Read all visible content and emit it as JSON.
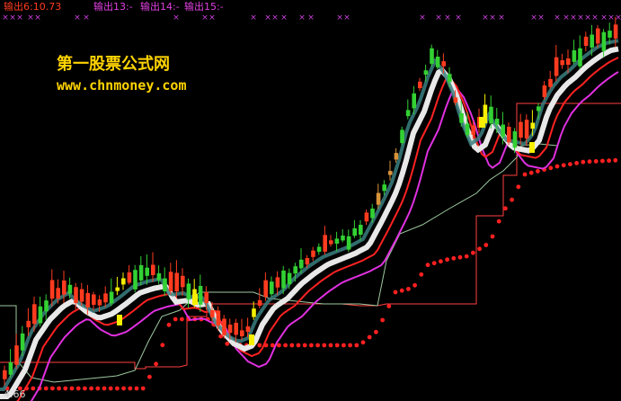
{
  "header": {
    "output6": "输出6:10.73",
    "output13": "输出13:-",
    "output14": "输出14:-",
    "output15": "输出15:-"
  },
  "watermark": {
    "title": "第一股票公式网",
    "url": "www.chnmoney.com"
  },
  "low_label": "4.66",
  "colors": {
    "bg": "#000000",
    "up": "#ff3b1f",
    "down": "#33d133",
    "white_ma": "#e8e8e8",
    "red_ma": "#ff2222",
    "magenta_ma": "#e030e0",
    "teal_ma": "#3a7f80",
    "step_line": "#ff4040",
    "dots": "#ff2020",
    "marks": "#d040e0",
    "watermark": "#ffd400"
  },
  "chart_data": {
    "type": "candlestick",
    "price_range": [
      4.66,
      10.73
    ],
    "marker_symbol": "×"
  }
}
